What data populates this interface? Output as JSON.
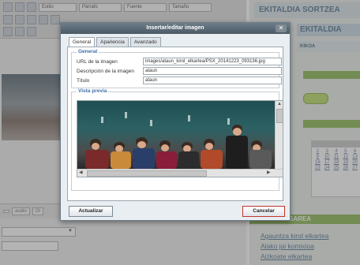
{
  "editor": {
    "toolbar": {
      "style_select": "Estilo",
      "paragraph_select": "Párrafo",
      "font_select": "Fuente",
      "size_select": "Tamaño"
    },
    "bottom_buttons": [
      "",
      "audio",
      "Ol"
    ]
  },
  "sidebar": {
    "title": "EKITALDIA SORTZEA",
    "tab": "EKITALDIA",
    "subheader": "KIKOA",
    "calendar_days": [
      "2",
      "3",
      "4",
      "5",
      "6",
      "9",
      "10",
      "11",
      "12",
      "13",
      "16",
      "17",
      "18",
      "19",
      "20",
      "23",
      "24",
      "25",
      "26",
      "27"
    ],
    "section_title": "SAREA",
    "links": [
      "Agauntza kirol elkartea",
      "Alako jai komixioa",
      "Aizkoate elkartea"
    ]
  },
  "dialog": {
    "title": "Insertar/editar imagen",
    "close_label": "✕",
    "tabs": [
      "General",
      "Apariencia",
      "Avanzado"
    ],
    "active_tab": 0,
    "general_legend": "General",
    "fields": {
      "image_url_label": "URL de la imagen",
      "image_url_value": "images/ataun_kirol_elkartea/PSX_20141223_093136.jpg",
      "description_label": "Descripción de la imagen",
      "description_value": "ataun",
      "title_label": "Título",
      "title_value": "ataun"
    },
    "preview_legend": "Vista previa",
    "update_button": "Actualizar",
    "cancel_button": "Cancelar"
  },
  "colors": {
    "accent_blue": "#3f6ea6",
    "sidebar_green": "#9cc26a",
    "cancel_border": "#c0352b"
  }
}
